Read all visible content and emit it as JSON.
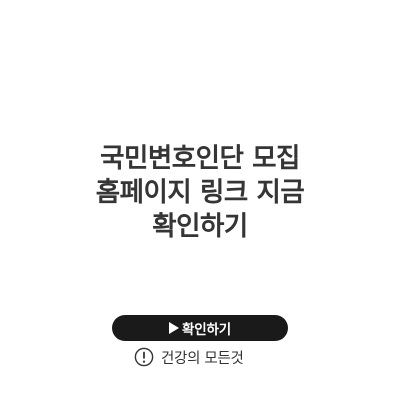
{
  "headline": {
    "lines": [
      "국민변호인단 모집",
      "홈페이지 링크 지금",
      "확인하기"
    ]
  },
  "cta": {
    "label": "확인하기",
    "icon": "play-triangle-icon"
  },
  "brand": {
    "name": "건강의 모든것",
    "icon": "exclamation-circle-icon"
  },
  "colors": {
    "background": "#ffffff",
    "headline": "#353535",
    "button": "#1a1a1a",
    "button_text": "#ffffff"
  }
}
